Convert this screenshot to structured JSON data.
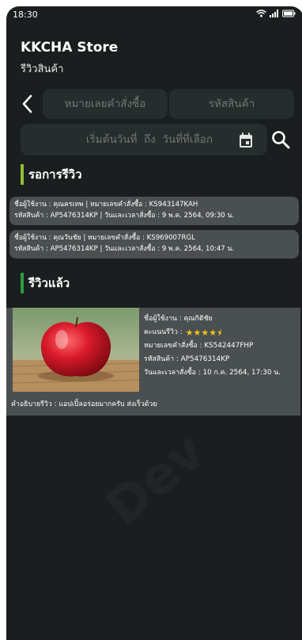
{
  "status_bar": {
    "time": "18:30"
  },
  "header": {
    "title": "KKCHA Store",
    "subtitle": "รีวิวสินค้า"
  },
  "filters": {
    "order_placeholder": "หมายเลยคำสั่งซื้อ",
    "product_placeholder": "รหัสสินค้า",
    "date_placeholder": "เริ่มต้นวันที่  ถึง  วันที่ที่เลือก"
  },
  "pending": {
    "title": "รอการรีวิว",
    "items": [
      {
        "line1": "ชื่อผู้ใช้งาน : คุณครเทพ | หมายเลขคำสั่งซื้อ : KS943147KAH",
        "line2": "รหัสสินค้า : AP5476314KP  | วันและเวลาสั่งซื้อ : 9 พ.ค. 2564, 09:30 น."
      },
      {
        "line1": "ชื่อผู้ใช้งาน : คุณวันชัย  | หมายเลขคำสั่งซื้อ : KS969007RGL",
        "line2": "รหัสสินค้า : AP5476314KP  | วันและเวลาสั่งซื้อ : 9 พ.ค. 2564, 10:47 น."
      }
    ]
  },
  "reviewed": {
    "title": "รีวิวแล้ว",
    "items": [
      {
        "user": "ชื่อผู้ใช้งาน : คุณกิติชัย",
        "rating_label": "คะแนนรีวิว :",
        "rating": 4.5,
        "stars": "★★★★⯨",
        "order": "หมายเลขคำสั่งซื้อ : KS542447FHP",
        "product": "รหัสสินค้า : AP5476314KP",
        "datetime": "วันและเวลาสั่งซื้อ : 10 ก.ค. 2564, 17:30 น.",
        "description": "คำอธิบายรีวิว : แอปเปิ้ลอร่อยมากครับ ส่งเร็วด้วย"
      }
    ]
  },
  "colors": {
    "background": "#1a1e1f",
    "card": "#4a4f50",
    "input": "#262d2d",
    "pending_accent": "#8fbf3a",
    "reviewed_accent": "#2e9e3e",
    "star": "#f2c21b"
  }
}
